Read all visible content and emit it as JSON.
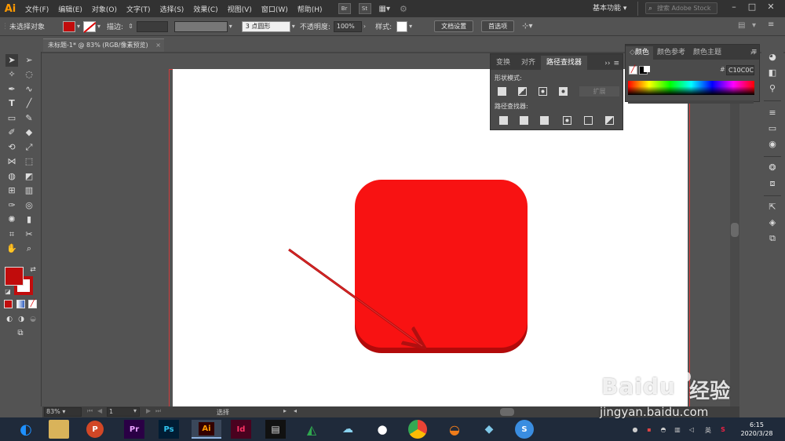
{
  "menubar": {
    "app_logo": "Ai",
    "items": [
      "文件(F)",
      "编辑(E)",
      "对象(O)",
      "文字(T)",
      "选择(S)",
      "效果(C)",
      "视图(V)",
      "窗口(W)",
      "帮助(H)"
    ],
    "bridge_label": "Br",
    "stock_label": "St",
    "workspace_label": "基本功能",
    "stock_search_placeholder": "搜索 Adobe Stock"
  },
  "controlbar": {
    "selection_status": "未选择对象",
    "stroke_label": "描边:",
    "brush_value": "3 点圆形",
    "opacity_label": "不透明度:",
    "opacity_value": "100%",
    "style_label": "样式:",
    "doc_setup_button": "文档设置",
    "preferences_button": "首选项",
    "fill_color": "#c10c0c"
  },
  "document": {
    "tab_title": "未标题-1* @ 83% (RGB/像素预览)",
    "close_glyph": "×"
  },
  "pathfinder_panel": {
    "tabs": [
      "变换",
      "对齐",
      "路径查找器"
    ],
    "active_tab": "路径查找器",
    "shape_modes_label": "形状模式:",
    "pathfinders_label": "路径查找器:",
    "expand_button": "扩展"
  },
  "color_panel": {
    "tabs": [
      "颜色",
      "颜色参考",
      "颜色主题"
    ],
    "active_tab": "颜色",
    "hex_prefix": "#",
    "hex_value": "C10C0C"
  },
  "statusbar": {
    "zoom": "83%",
    "artboard_number": "1",
    "tool_label": "选择"
  },
  "taskbar": {
    "apps": [
      {
        "name": "PowerPoint",
        "label": "P"
      },
      {
        "name": "Premiere",
        "label": "Pr"
      },
      {
        "name": "Photoshop",
        "label": "Ps"
      },
      {
        "name": "Illustrator",
        "label": "Ai"
      },
      {
        "name": "InDesign",
        "label": "Id"
      }
    ],
    "time": "6:15",
    "date": "2020/3/28"
  },
  "watermark": {
    "brand_text": "Bai",
    "brand_text2": "du",
    "cn_text": "经验",
    "url": "jingyan.baidu.com"
  }
}
